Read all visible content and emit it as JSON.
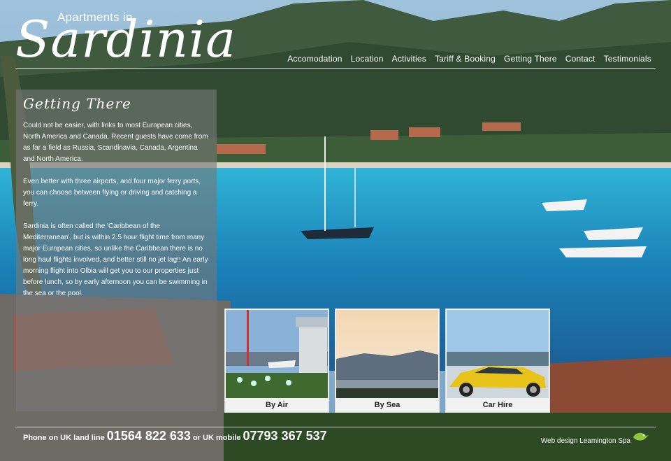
{
  "logo": {
    "small": "Apartments in",
    "big": "Sardinia"
  },
  "nav": {
    "items": [
      "Accomodation",
      "Location",
      "Activities",
      "Tariff & Booking",
      "Getting There",
      "Contact",
      "Testimonials"
    ]
  },
  "panel": {
    "title": "Getting There",
    "paragraphs": [
      "Could not be easier, with links to most European cities, North America and Canada. Recent guests have come from as far a field as Russia, Scandinavia, Canada, Argentina and North America.",
      "Even better with three airports, and four major ferry ports, you can choose between flying or driving and catching a ferry.",
      "Sardinia is often called the 'Caribbean of the Mediterranean', but is within 2.5 hour flight time from many major European cities, so unlike the Caribbean there is no long haul flights involved, and better still no jet lag!! An early morning flight into Olbia will get you to our properties just before lunch, so by early afternoon you can be swimming in the sea or the pool."
    ]
  },
  "tiles": [
    {
      "label": "By Air"
    },
    {
      "label": "By Sea"
    },
    {
      "label": "Car Hire"
    }
  ],
  "footer": {
    "landline_label": "Phone on UK land line",
    "landline": "01564 822 633",
    "or_mobile": "or UK mobile",
    "mobile": "07793 367 537",
    "credit": "Web design Leamington Spa"
  }
}
